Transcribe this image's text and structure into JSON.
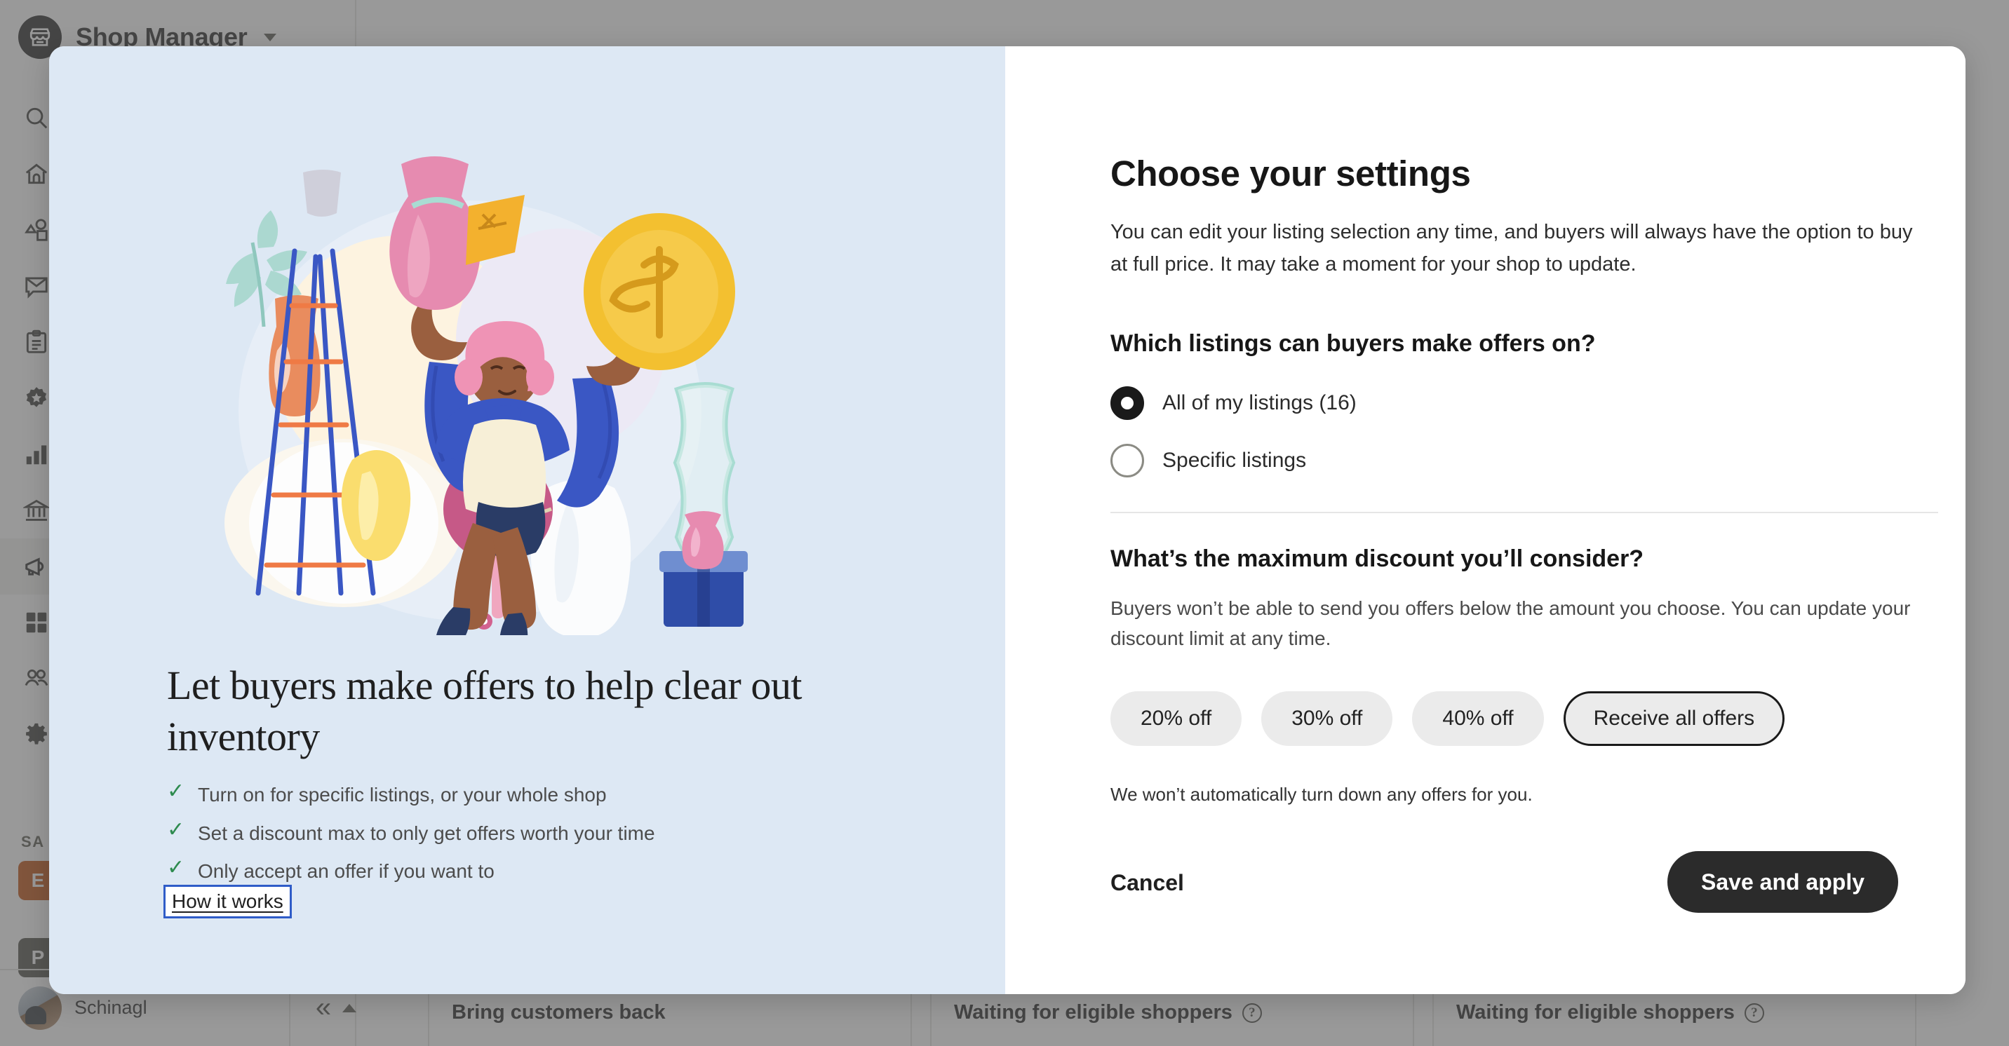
{
  "app": {
    "brand": {
      "name": "Shop Manager",
      "logo_icon": "storefront-icon",
      "caret_icon": "chevron-down-icon"
    },
    "sidebar": {
      "items": [
        {
          "label": "",
          "icon": "search-icon",
          "active": false
        },
        {
          "label": "",
          "icon": "home-icon",
          "active": false
        },
        {
          "label": "",
          "icon": "listings-icon",
          "active": false
        },
        {
          "label": "",
          "icon": "messages-icon",
          "active": false
        },
        {
          "label": "",
          "icon": "orders-clipboard-icon",
          "active": false
        },
        {
          "label": "",
          "icon": "star-badge-icon",
          "active": false
        },
        {
          "label": "",
          "icon": "stats-bar-chart-icon",
          "active": false
        },
        {
          "label": "",
          "icon": "finances-bank-icon",
          "active": false
        },
        {
          "label": "",
          "icon": "marketing-megaphone-icon",
          "active": true
        },
        {
          "label": "",
          "icon": "apps-grid-icon",
          "active": false
        },
        {
          "label": "",
          "icon": "community-people-icon",
          "active": false
        },
        {
          "label": "",
          "icon": "settings-gear-icon",
          "active": false
        }
      ],
      "section_label": "SA",
      "badges": [
        {
          "label": "E",
          "color": "#c14d0c"
        },
        {
          "label": "P",
          "color": "#4c4c46"
        }
      ],
      "user": {
        "name": "Schinagl",
        "caret_icon": "chevron-up-icon"
      },
      "collapse_icon": "«"
    },
    "cards": [
      {
        "title": "Bring customers back",
        "has_help": false
      },
      {
        "title": "Waiting for eligible shoppers",
        "has_help": true,
        "help_icon": "question-mark-icon"
      },
      {
        "title": "Waiting for eligible shoppers",
        "has_help": true,
        "help_icon": "question-mark-icon"
      }
    ]
  },
  "modal": {
    "left": {
      "heading": "Let buyers make offers to help clear out inventory",
      "bullets": [
        "Turn on for specific listings, or your whole shop",
        "Set a discount max to only get offers worth your time",
        "Only accept an offer if you want to"
      ],
      "check_icon": "check-icon",
      "link_label": "How it works",
      "illustration_alt": "seller-holding-vase-and-coin-illustration",
      "background_color": "#dde8f4"
    },
    "right": {
      "title": "Choose your settings",
      "subtitle": "You can edit your listing selection any time, and buyers will always have the option to buy at full price. It may take a moment for your shop to update.",
      "listings_question": "Which listings can buyers make offers on?",
      "listings_options": [
        {
          "label": "All of my listings (16)",
          "selected": true
        },
        {
          "label": "Specific listings",
          "selected": false
        }
      ],
      "discount_question": "What’s the maximum discount you’ll consider?",
      "discount_subtitle": "Buyers won’t be able to send you offers below the amount you choose. You can update your discount limit at any time.",
      "discount_options": [
        {
          "label": "20% off",
          "selected": false
        },
        {
          "label": "30% off",
          "selected": false
        },
        {
          "label": "40% off",
          "selected": false
        },
        {
          "label": "Receive all offers",
          "selected": true
        }
      ],
      "discount_note": "We won’t automatically turn down any offers for you.",
      "cancel_label": "Cancel",
      "save_label": "Save and apply",
      "accent_dark": "#2b2b2b",
      "focus_blue": "#2f5cc8"
    }
  }
}
